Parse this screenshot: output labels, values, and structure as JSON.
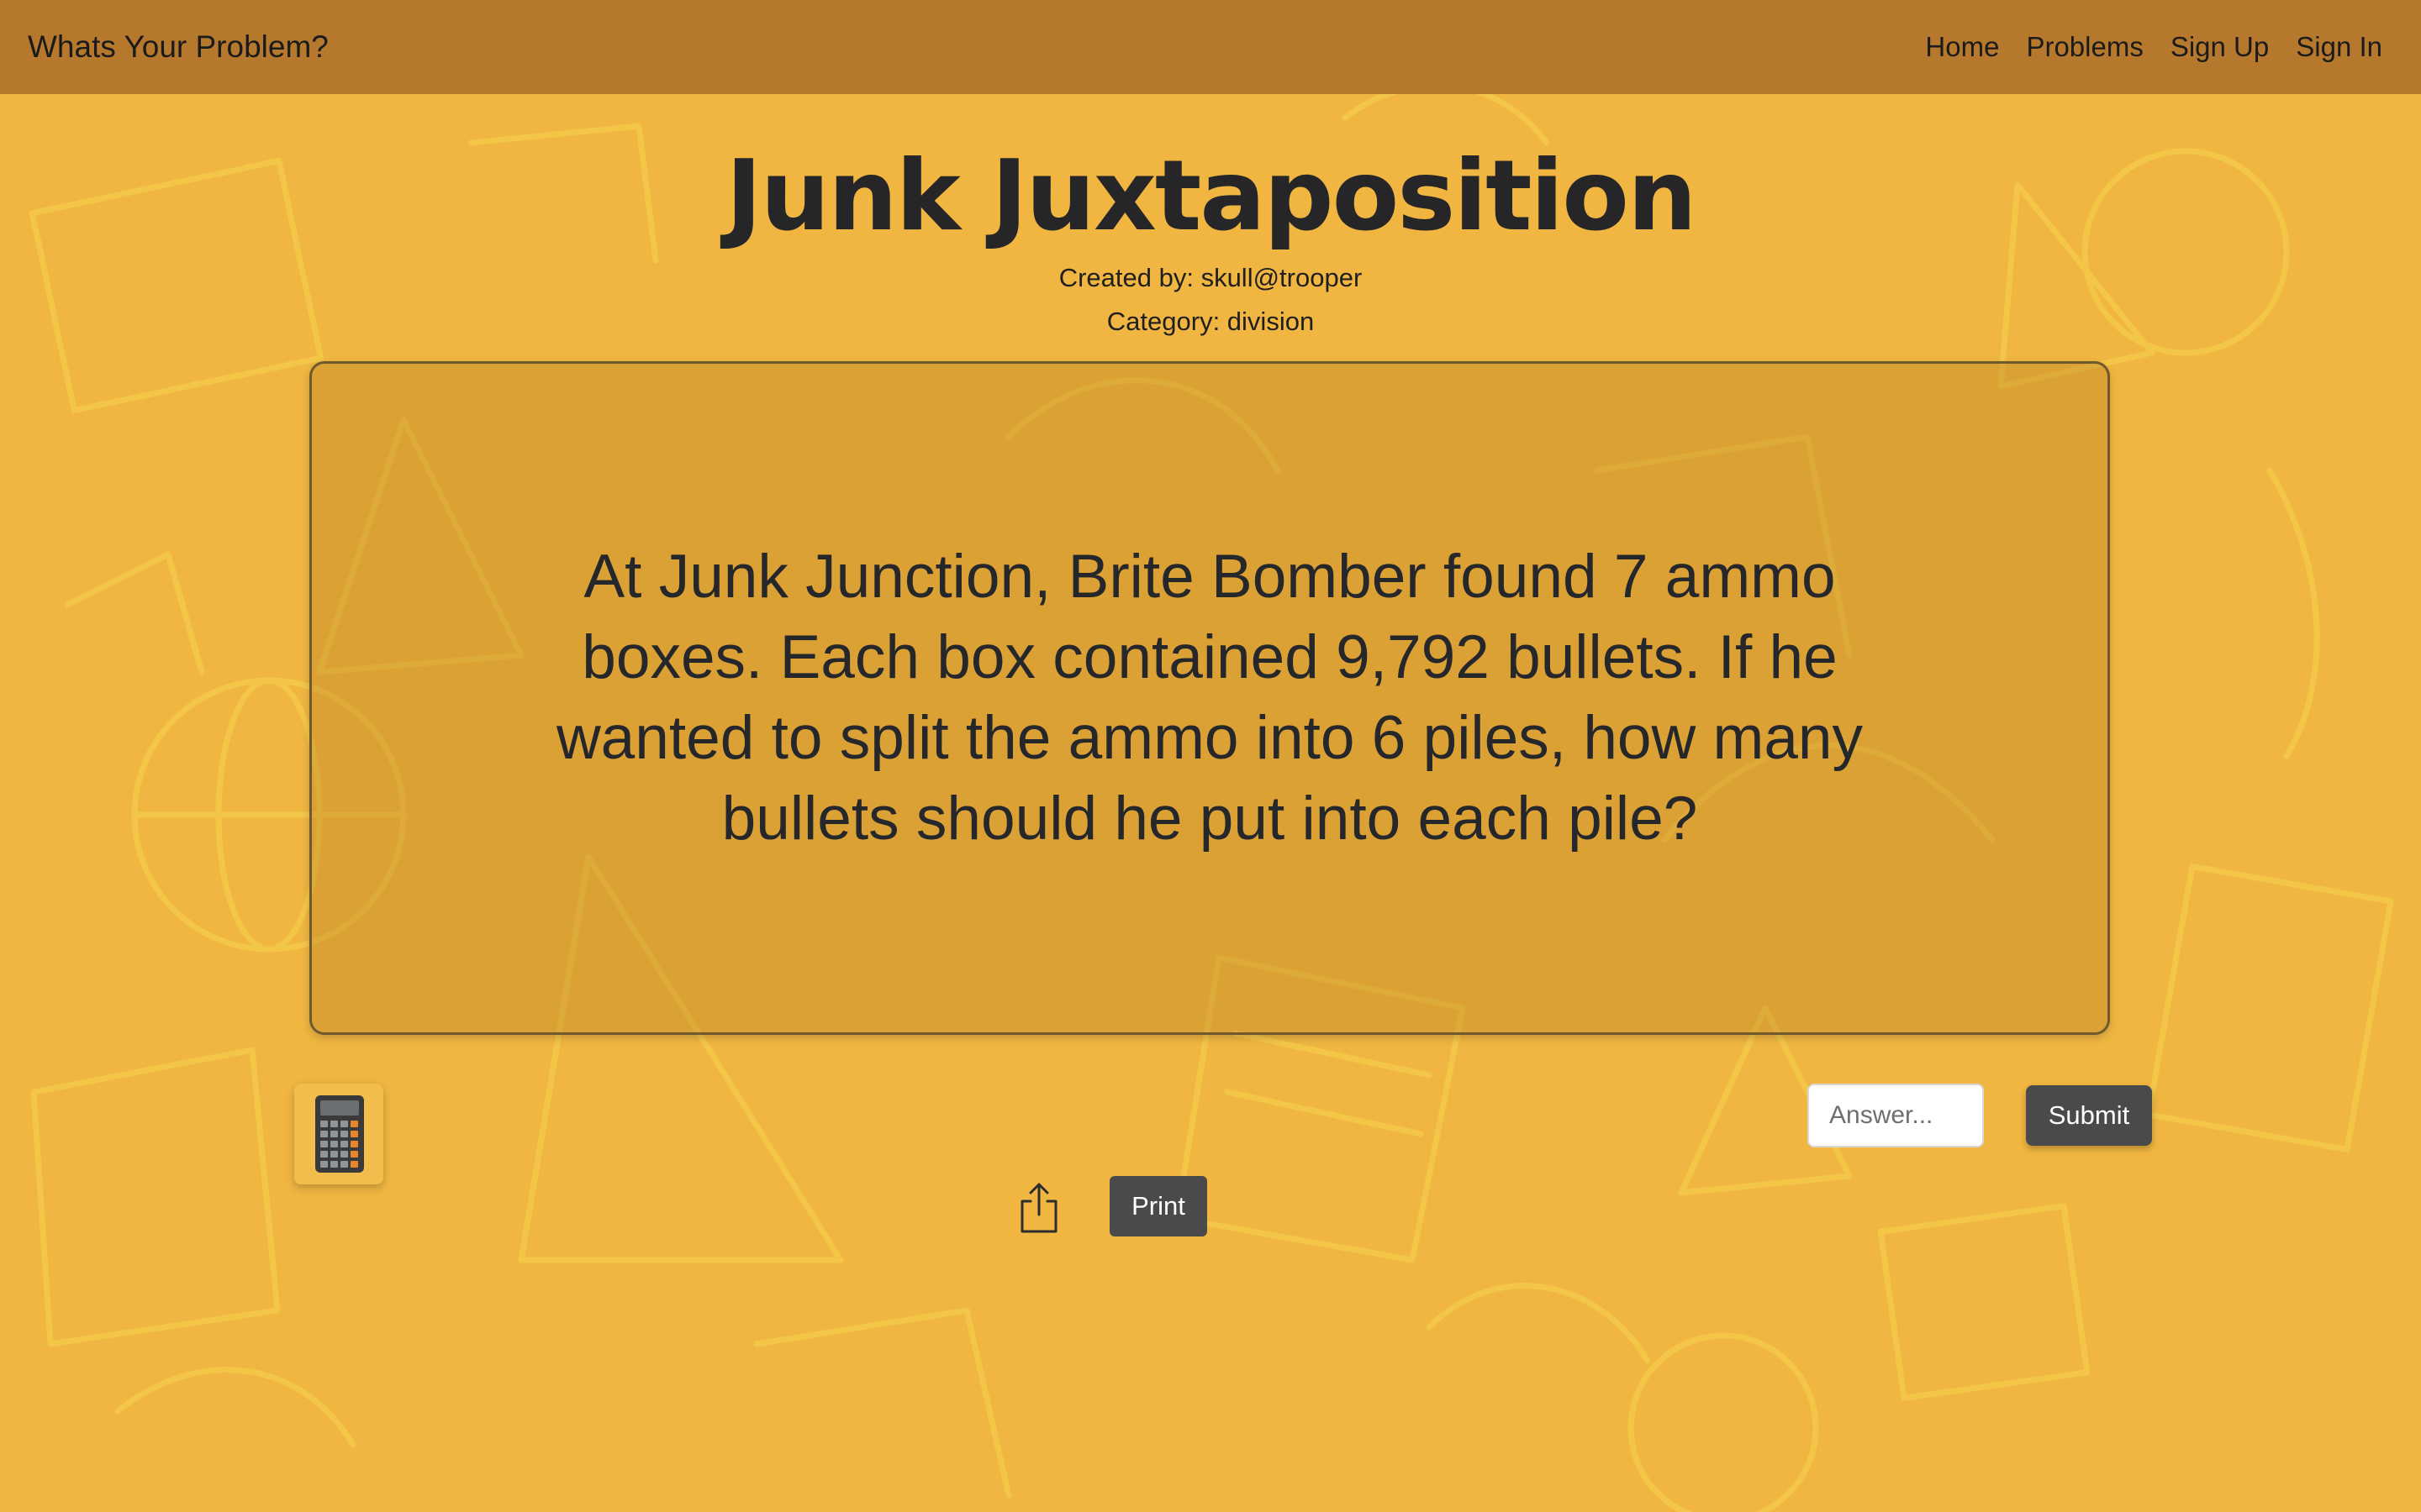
{
  "navbar": {
    "brand": "Whats Your Problem?",
    "links": [
      "Home",
      "Problems",
      "Sign Up",
      "Sign In"
    ]
  },
  "problem": {
    "title": "Junk Juxtaposition",
    "created_by": "Created by: skull@trooper",
    "category": "Category: division",
    "text": "At Junk Junction, Brite Bomber found 7 ammo boxes. Each box contained 9,792 bullets. If he wanted to split the ammo into 6 piles, how many bullets should he put into each pile?"
  },
  "answer": {
    "value": "",
    "placeholder": "Answer..."
  },
  "buttons": {
    "submit": "Submit",
    "print": "Print"
  },
  "icons": {
    "calculator": "calculator-icon",
    "share": "share-icon"
  },
  "colors": {
    "background": "#f0b641",
    "navbar": "#b6782c",
    "button": "#4a4a4a",
    "doodle_lines": "#f7d44f"
  }
}
